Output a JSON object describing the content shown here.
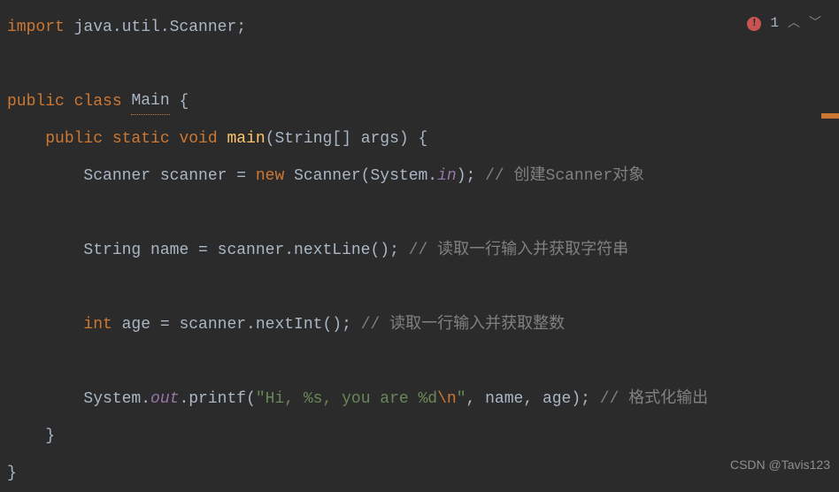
{
  "problems": {
    "errorCount": "1"
  },
  "code": {
    "line1": {
      "kw_import": "import",
      "pkg": " java.util.Scanner",
      "semi": ";"
    },
    "line3": {
      "kw_public": "public",
      "kw_class": " class ",
      "name": "Main",
      "brace": " {"
    },
    "line4": {
      "indent": "    ",
      "kw_public": "public",
      "kw_static": " static ",
      "kw_void": "void",
      "method": " main",
      "params": "(String[] args) {"
    },
    "line5": {
      "indent": "        ",
      "type": "Scanner scanner = ",
      "kw_new": "new",
      "ctor": " Scanner(System.",
      "field": "in",
      "tail": ")",
      "semi": "; ",
      "comment": "// 创建Scanner对象"
    },
    "line7": {
      "indent": "        ",
      "decl": "String name = scanner.nextLine()",
      "semi": "; ",
      "comment": "// 读取一行输入并获取字符串"
    },
    "line9": {
      "indent": "        ",
      "kw_int": "int",
      "decl": " age = scanner.nextInt()",
      "semi": "; ",
      "comment": "// 读取一行输入并获取整数"
    },
    "line11": {
      "indent": "        ",
      "sys": "System.",
      "field": "out",
      "call": ".printf(",
      "str1": "\"Hi, %s, you are %d",
      "esc": "\\n",
      "str2": "\"",
      "args": ", name, age)",
      "semi": "; ",
      "comment": "// 格式化输出"
    },
    "line12": {
      "indent": "    ",
      "brace": "}"
    },
    "line13": {
      "brace": "}"
    }
  },
  "watermark": "CSDN @Tavis123"
}
